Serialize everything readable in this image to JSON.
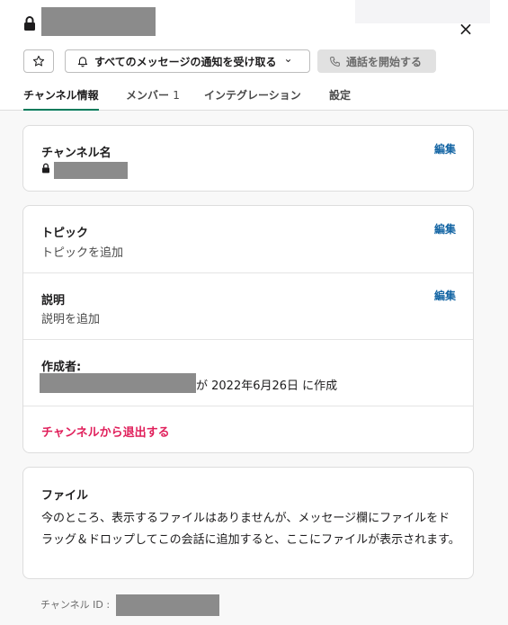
{
  "header": {
    "close_symbol": "×",
    "star_icon": "star-icon",
    "notify_label": "すべてのメッセージの通知を受け取る",
    "notify_chevron": "⌄",
    "call_label": "通話を開始する"
  },
  "tabs": [
    {
      "label": "チャンネル情報",
      "active": true
    },
    {
      "label": "メンバー",
      "count": "1"
    },
    {
      "label": "インテグレーション"
    },
    {
      "label": "設定"
    }
  ],
  "channel_name": {
    "title": "チャンネル名",
    "edit": "編集"
  },
  "topic": {
    "title": "トピック",
    "text": "トピックを追加",
    "edit": "編集"
  },
  "description": {
    "title": "説明",
    "text": "説明を追加",
    "edit": "編集"
  },
  "creator": {
    "title": "作成者:",
    "created_text": "が 2022年6月26日 に作成"
  },
  "leave": {
    "label": "チャンネルから退出する"
  },
  "files": {
    "title": "ファイル",
    "text": "今のところ、表示するファイルはありませんが、メッセージ欄にファイルをドラッグ＆ドロップしてこの会話に追加すると、ここにファイルが表示されます。"
  },
  "footer": {
    "channel_id_label": "チャンネル ID :"
  },
  "colors": {
    "accent": "#007a5a",
    "link": "#1264a3",
    "danger": "#e01e5a",
    "redaction": "#8b8b8b"
  }
}
